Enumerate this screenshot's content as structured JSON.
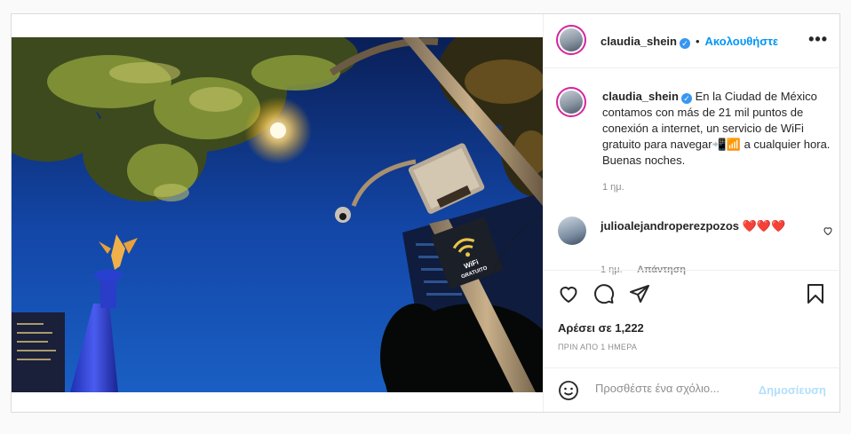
{
  "post": {
    "author": "claudia_shein",
    "follow_label": "Ακολουθήστε",
    "dot": "•",
    "more_label": "•••",
    "verified_glyph": "✓",
    "caption": "En la Ciudad de México contamos con más de 21 mil puntos de conexión a internet, un servicio de WiFi gratuito para navegar📲📶 a cualquier hora. Buenas noches.",
    "caption_time": "1 ημ.",
    "photo_sign_line1": "WiFi",
    "photo_sign_line2": "GRATUITO",
    "comments": [
      {
        "user": "julioalejandroperezpozos",
        "text": "❤️❤️❤️",
        "time": "1 ημ.",
        "reply_label": "Απάντηση"
      }
    ],
    "likes": "Αρέσει σε 1,222",
    "posted_ago": "ΠΡΙΝ ΑΠΟ 1 ΗΜΕΡΑ",
    "comment_placeholder": "Προσθέστε ένα σχόλιο...",
    "publish_label": "Δημοσίευση"
  },
  "icons": {
    "like": "heart-icon",
    "comment": "comment-icon",
    "share": "paper-plane-icon",
    "save": "bookmark-icon",
    "emoji": "emoji-icon",
    "more": "more-options-icon",
    "verified": "verified-badge-icon"
  },
  "colors": {
    "accent": "#0095f6",
    "publish_disabled": "#b2dffc",
    "verified": "#3897f0",
    "heart": "#ed4956"
  }
}
